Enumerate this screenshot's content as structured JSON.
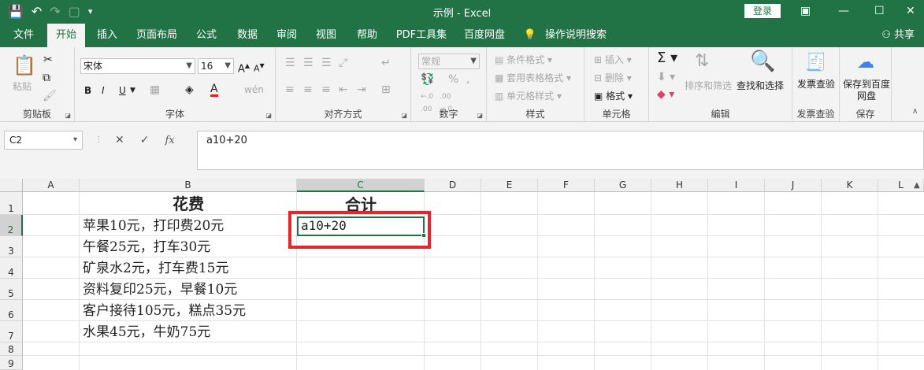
{
  "window": {
    "title": "示例 - Excel",
    "login_label": "登录",
    "share_label": "共享"
  },
  "tabs": [
    "文件",
    "开始",
    "插入",
    "页面布局",
    "公式",
    "数据",
    "审阅",
    "视图",
    "帮助",
    "PDF工具集",
    "百度网盘",
    "操作说明搜索"
  ],
  "active_tab": "开始",
  "ribbon": {
    "clipboard": {
      "label": "剪贴板",
      "paste": "粘贴"
    },
    "font": {
      "label": "字体",
      "font_name": "宋体",
      "font_size": "16",
      "bold": "B",
      "italic": "I",
      "underline": "U"
    },
    "alignment": {
      "label": "对齐方式"
    },
    "number": {
      "label": "数字",
      "format": "常规",
      "percent": "%"
    },
    "styles": {
      "label": "样式",
      "conditional": "条件格式",
      "table": "套用表格格式",
      "cell_style": "单元格样式"
    },
    "cells": {
      "label": "单元格",
      "insert": "插入",
      "delete": "删除",
      "format": "格式"
    },
    "editing": {
      "label": "编辑",
      "sort": "排序和筛选",
      "find": "查找和选择"
    },
    "invoice": {
      "label": "发票查验",
      "btn": "发票查验"
    },
    "save": {
      "label": "保存",
      "btn": "保存到百度网盘"
    }
  },
  "formula_bar": {
    "name_box": "C2",
    "fx": "fx",
    "value": "a10+20"
  },
  "sheet": {
    "columns": [
      "A",
      "B",
      "C",
      "D",
      "E",
      "F",
      "G",
      "H",
      "I",
      "J",
      "K",
      "L"
    ],
    "selected_column": "C",
    "rows": [
      "1",
      "2",
      "3",
      "4",
      "5",
      "6",
      "7",
      "8",
      "9"
    ],
    "selected_row": "2",
    "header_b": "花费",
    "header_c": "合计",
    "b_cells": [
      "苹果10元，打印费20元",
      "午餐25元，打车30元",
      "矿泉水2元，打车费15元",
      "资料复印25元，早餐10元",
      "客户接待105元，糕点35元",
      "水果45元，牛奶75元"
    ],
    "c2_value": "a10+20"
  },
  "colors": {
    "accent": "#217346",
    "highlight": "#e8262a"
  }
}
